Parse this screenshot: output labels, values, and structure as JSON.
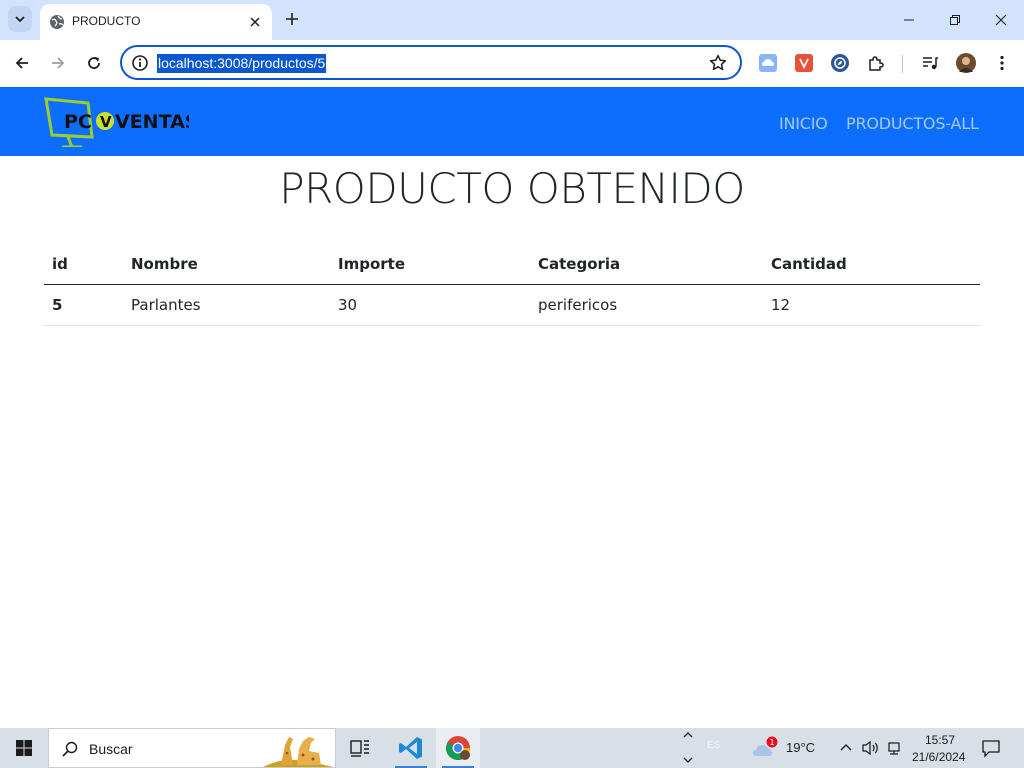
{
  "browser": {
    "tab_title": "PRODUCTO",
    "url": "localhost:3008/productos/5"
  },
  "site": {
    "nav_links": [
      "INICIO",
      "PRODUCTOS-ALL"
    ]
  },
  "page": {
    "heading": "PRODUCTO OBTENIDO"
  },
  "table": {
    "headers": [
      "id",
      "Nombre",
      "Importe",
      "Categoria",
      "Cantidad"
    ],
    "rows": [
      [
        "5",
        "Parlantes",
        "30",
        "perifericos",
        "12"
      ]
    ]
  },
  "taskbar": {
    "search_placeholder": "Buscar",
    "language": "ES",
    "weather_badge": "1",
    "temperature": "19°C",
    "time": "15:57",
    "date": "21/6/2024"
  },
  "colors": {
    "navbar": "#0d6efd",
    "tabstrip": "#d3e3fd",
    "url_highlight": "#0b57d0"
  }
}
